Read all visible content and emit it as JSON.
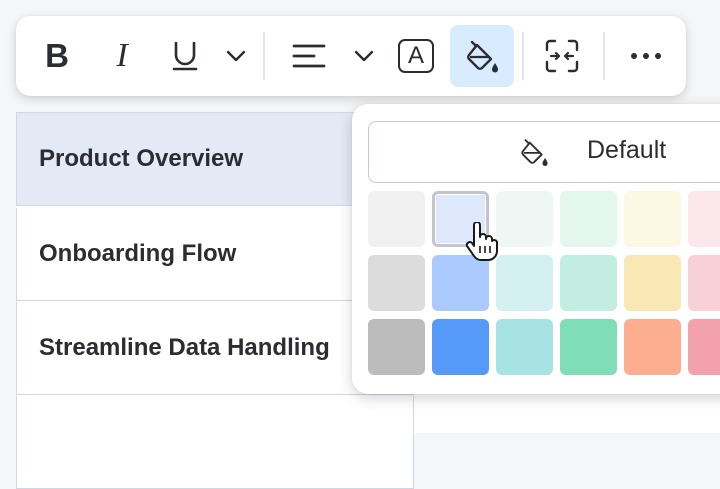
{
  "toolbar": {
    "bold_label": "B",
    "italic_label": "I",
    "text_color_label": "A",
    "icons": [
      "bold-icon",
      "italic-icon",
      "underline-icon",
      "chevron-down-icon",
      "align-left-icon",
      "chevron-down-icon",
      "text-color-icon",
      "fill-bucket-icon",
      "expand-icon",
      "more-icon"
    ]
  },
  "table": {
    "rows": [
      {
        "title": "Product Overview",
        "selected": true
      },
      {
        "title": "Onboarding Flow",
        "selected": false
      },
      {
        "title": "Streamline Data Handling",
        "selected": false
      },
      {
        "title": "",
        "selected": false
      }
    ]
  },
  "color_menu": {
    "default_label": "Default",
    "swatch_rows": [
      [
        "#f1f1f2",
        "#dde8fc",
        "#eff7f5",
        "#e4f7ee",
        "#fdf8e4",
        "#fce8ec"
      ],
      [
        "#dcdcdd",
        "#aac9fc",
        "#d4f0f0",
        "#c2ede0",
        "#f9e8b6",
        "#f8d1d7"
      ],
      [
        "#bcbcbc",
        "#5599f9",
        "#a6e3e2",
        "#7fddb7",
        "#fdae91",
        "#f3a2ad"
      ]
    ],
    "selected_swatch": [
      0,
      1
    ]
  },
  "colors": {
    "accent": "#d9ebff",
    "text": "#2b2d33",
    "selected_row": "#e4e9f6",
    "border": "#cfd6e6"
  }
}
